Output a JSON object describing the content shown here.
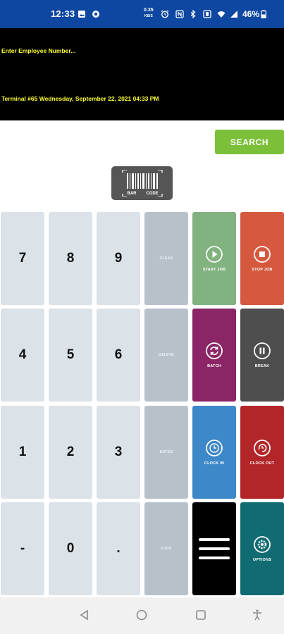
{
  "status_bar": {
    "time": "12:33",
    "net_speed_value": "0.35",
    "net_speed_unit": "KB/S",
    "battery": "46%"
  },
  "info": {
    "prompt": "Enter Employee Number...",
    "terminal_line": "Terminal #65  Wednesday, September 22, 2021 04:33 PM"
  },
  "search": {
    "label": "SEARCH"
  },
  "barcode": {
    "label_left": "BAR",
    "label_right": "CODE"
  },
  "keypad": {
    "digits": [
      "7",
      "8",
      "9",
      "4",
      "5",
      "6",
      "1",
      "2",
      "3",
      "-",
      "0",
      "."
    ],
    "controls": [
      "CLEAR",
      "DELETE",
      "ENTER",
      "FOOD"
    ],
    "actions": {
      "start_job": "START JOB",
      "stop_job": "STOP JOB",
      "batch": "BATCH",
      "break": "BREAK",
      "clock_in": "CLOCK IN",
      "clock_out": "CLOCK OUT",
      "options": "OPTIONS"
    }
  },
  "colors": {
    "status_bar": "#0d47a1",
    "prompt_text": "#ffff33",
    "search": "#7cc03a",
    "start_job": "#82b27f",
    "stop_job": "#d4593f",
    "batch": "#8b2565",
    "break": "#4e4e4e",
    "clock_in": "#3d88c8",
    "clock_out": "#b2262a",
    "menu": "#000000",
    "options": "#116b72"
  },
  "icons": {
    "start_job": "play-circle-icon",
    "stop_job": "stop-circle-icon",
    "batch": "refresh-circle-icon",
    "break": "pause-circle-icon",
    "clock_in": "clock-circle-icon",
    "clock_out": "clock-out-icon",
    "menu": "hamburger-menu-icon",
    "options": "gear-icon"
  }
}
